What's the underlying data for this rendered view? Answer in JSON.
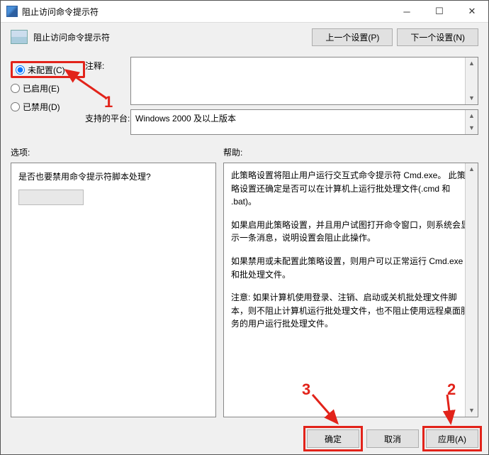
{
  "window": {
    "title": "阻止访问命令提示符"
  },
  "toolbar": {
    "heading": "阻止访问命令提示符",
    "prev": "上一个设置(P)",
    "next": "下一个设置(N)"
  },
  "radios": {
    "not_configured": "未配置(C)",
    "enabled": "已启用(E)",
    "disabled": "已禁用(D)"
  },
  "fields": {
    "comment_label": "注释:",
    "platform_label": "支持的平台:",
    "platform_value": "Windows 2000 及以上版本"
  },
  "labels": {
    "options": "选项:",
    "help": "帮助:"
  },
  "options": {
    "question": "是否也要禁用命令提示符脚本处理?"
  },
  "help": {
    "p1": "此策略设置将阻止用户运行交互式命令提示符 Cmd.exe。 此策略设置还确定是否可以在计算机上运行批处理文件(.cmd 和 .bat)。",
    "p2": "如果启用此策略设置，并且用户试图打开命令窗口，则系统会显示一条消息，说明设置会阻止此操作。",
    "p3": "如果禁用或未配置此策略设置，则用户可以正常运行 Cmd.exe 和批处理文件。",
    "p4": "注意: 如果计算机使用登录、注销、启动或关机批处理文件脚本，则不阻止计算机运行批处理文件，也不阻止使用远程桌面服务的用户运行批处理文件。"
  },
  "footer": {
    "ok": "确定",
    "cancel": "取消",
    "apply": "应用(A)"
  },
  "annotations": {
    "n1": "1",
    "n2": "2",
    "n3": "3"
  }
}
